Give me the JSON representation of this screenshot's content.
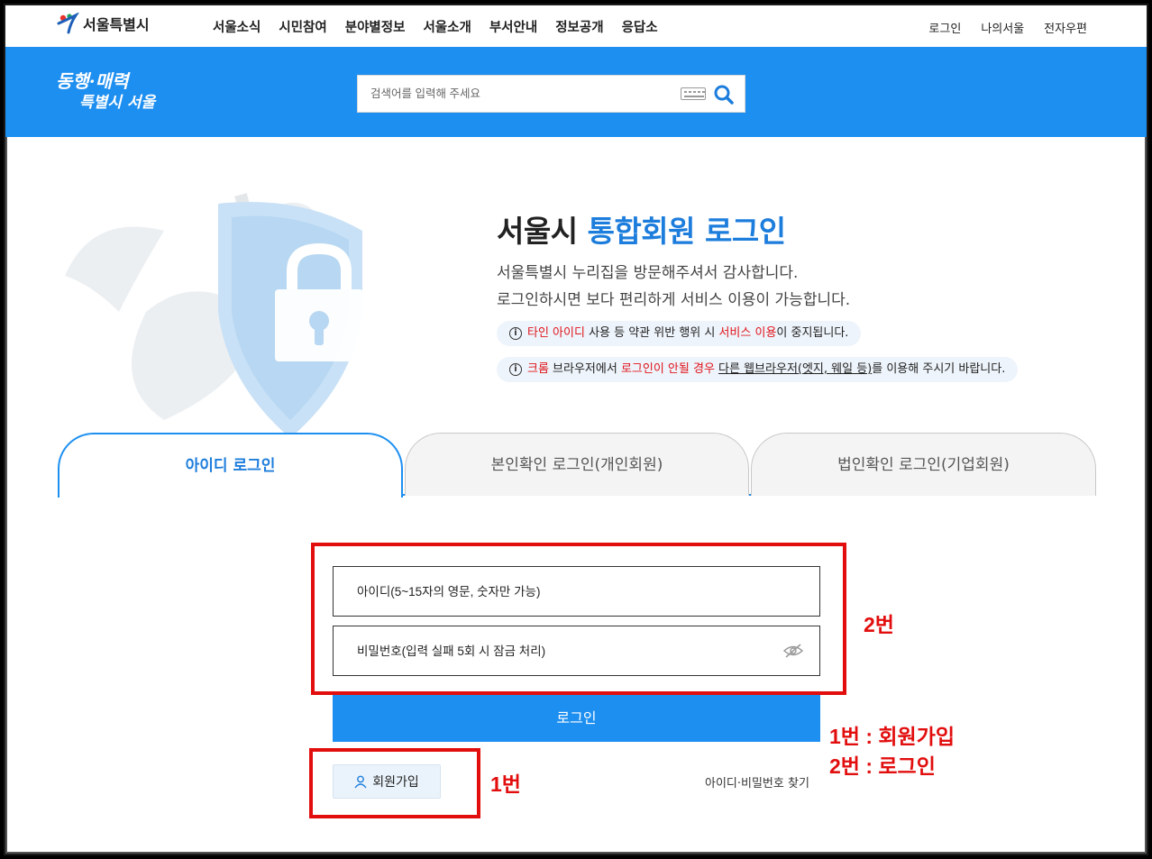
{
  "gnb": {
    "logo_text": "서울특별시",
    "menu": [
      "서울소식",
      "시민참여",
      "분야별정보",
      "서울소개",
      "부서안내",
      "정보공개",
      "응답소"
    ],
    "util": [
      "로그인",
      "나의서울",
      "전자우편"
    ]
  },
  "header": {
    "slogan_line1": "동행·매력",
    "slogan_line2": "특별시 서울",
    "search_placeholder": "검색어를 입력해 주세요"
  },
  "main": {
    "title_black": "서울시 ",
    "title_blue": "통합회원 로그인",
    "desc_line1": "서울특별시 누리집을 방문해주셔서 감사합니다.",
    "desc_line2": "로그인하시면 보다 편리하게 서비스 이용이 가능합니다.",
    "notice1": {
      "a_red": "타인 아이디",
      "b": " 사용 등 약관 위반 행위 시 ",
      "c_red": "서비스 이용",
      "d": "이 중지됩니다."
    },
    "notice2": {
      "a_red": "크롬",
      "b": " 브라우저에서 ",
      "c_red": "로그인이 안될 경우",
      "d": " ",
      "e_ul": "다른 웹브라우저(엣지, 웨일 등)",
      "f": "를 이용해 주시기 바랍니다."
    }
  },
  "tabs": [
    "아이디 로그인",
    "본인확인 로그인(개인회원)",
    "법인확인 로그인(기업회원)"
  ],
  "form": {
    "id_placeholder": "아이디(5~15자의 영문, 숫자만 가능)",
    "pw_placeholder": "비밀번호(입력 실패 5회 시 잠금 처리)",
    "login_label": "로그인",
    "join_label": "회원가입",
    "find_label": "아이디·비밀번호 찾기"
  },
  "annotations": {
    "box2_label": "2번",
    "box1_label": "1번",
    "legend1": "1번 : 회원가입",
    "legend2": "2번 : 로그인"
  },
  "colors": {
    "brand_blue": "#1d8ff0",
    "annotation_red": "#e20e0e"
  }
}
